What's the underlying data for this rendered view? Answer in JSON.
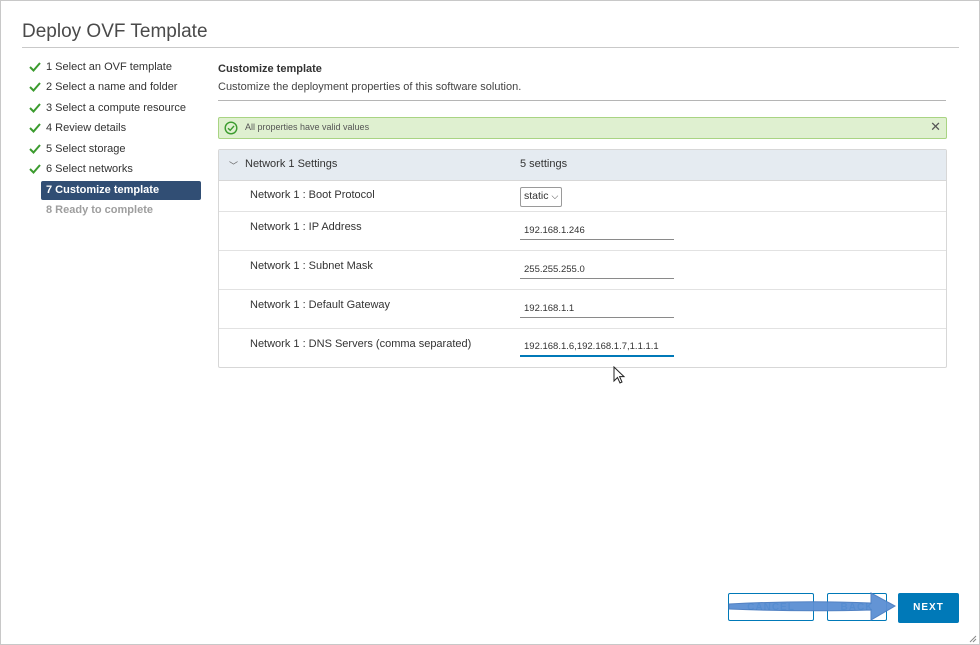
{
  "dialog": {
    "title": "Deploy OVF Template"
  },
  "steps": [
    {
      "label": "1 Select an OVF template",
      "state": "done"
    },
    {
      "label": "2 Select a name and folder",
      "state": "done"
    },
    {
      "label": "3 Select a compute resource",
      "state": "done"
    },
    {
      "label": "4 Review details",
      "state": "done"
    },
    {
      "label": "5 Select storage",
      "state": "done"
    },
    {
      "label": "6 Select networks",
      "state": "done"
    },
    {
      "label": "7 Customize template",
      "state": "active"
    },
    {
      "label": "8 Ready to complete",
      "state": "disabled"
    }
  ],
  "main": {
    "heading": "Customize template",
    "subheading": "Customize the deployment properties of this software solution."
  },
  "alert": {
    "text": "All properties have valid values",
    "color": "#dff0d0"
  },
  "group": {
    "name": "Network 1 Settings",
    "count": "5 settings",
    "boot_protocol": {
      "label": "Network 1 : Boot Protocol",
      "value": "static"
    },
    "ip_address": {
      "label": "Network 1 : IP Address",
      "value": "192.168.1.246"
    },
    "subnet_mask": {
      "label": "Network 1 : Subnet Mask",
      "value": "255.255.255.0"
    },
    "gateway": {
      "label": "Network 1 : Default Gateway",
      "value": "192.168.1.1"
    },
    "dns": {
      "label": "Network 1 : DNS Servers (comma separated)",
      "value": "192.168.1.6,192.168.1.7,1.1.1.1"
    }
  },
  "buttons": {
    "cancel": "CANCEL",
    "back": "BACK",
    "next": "NEXT"
  },
  "colors": {
    "accent": "#0079b8",
    "active_step": "#314e74",
    "check": "#3b9b2e"
  }
}
